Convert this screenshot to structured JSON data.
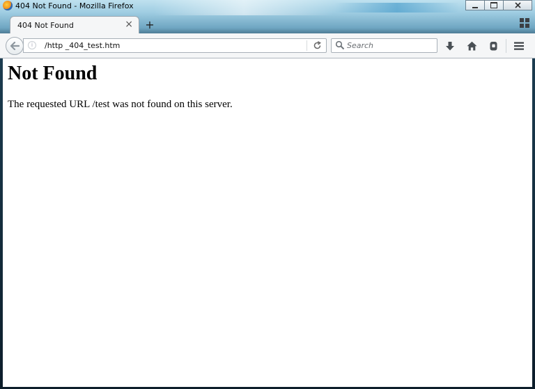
{
  "window": {
    "title": "404 Not Found - Mozilla Firefox",
    "app_icon": "firefox-logo",
    "controls": [
      "minimize-icon",
      "restore-icon",
      "close-icon"
    ]
  },
  "tabs": [
    {
      "label": "404 Not Found",
      "active": true,
      "close_glyph": "×"
    }
  ],
  "tabstrip": {
    "new_tab_glyph": "+",
    "tab_groups_icon": "tab-groups-icon"
  },
  "navbar": {
    "back_icon": "back-arrow-icon",
    "identity_icon": "info-icon",
    "url": "/http _404_test.htm",
    "reload_icon": "reload-icon",
    "search": {
      "placeholder": "Search",
      "value": ""
    },
    "toolbar_icons": [
      "download-icon",
      "home-icon",
      "pocket-icon",
      "menu-icon"
    ]
  },
  "page": {
    "heading": "Not Found",
    "message": "The requested URL /test was not found on this server."
  },
  "colors": {
    "chrome": "#f5f6f7",
    "content_background": "#ffffff",
    "text": "#000000"
  }
}
